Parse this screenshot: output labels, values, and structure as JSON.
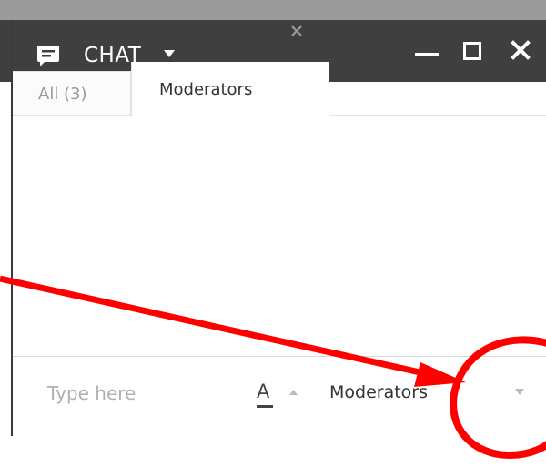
{
  "chat": {
    "title": "CHAT",
    "tabs": [
      {
        "label": "All (3)",
        "active": false
      },
      {
        "label": "Moderators",
        "active": true,
        "closable": true
      }
    ],
    "input": {
      "placeholder": "Type here"
    },
    "font_button": {
      "label": "A"
    },
    "recipient": {
      "selected": "Moderators"
    }
  },
  "icons": {
    "chat": "chat-bubble-icon",
    "title_dropdown": "caret-down-icon",
    "minimize": "minimize-icon",
    "maximize": "maximize-icon",
    "close": "close-icon",
    "tab_close": "close-icon",
    "font_menu": "caret-up-icon",
    "recipient_dropdown": "caret-down-icon"
  },
  "colors": {
    "titlebar": "#3f3f3f",
    "top_strip": "#9b9b9b",
    "annotation": "#ff0000"
  }
}
